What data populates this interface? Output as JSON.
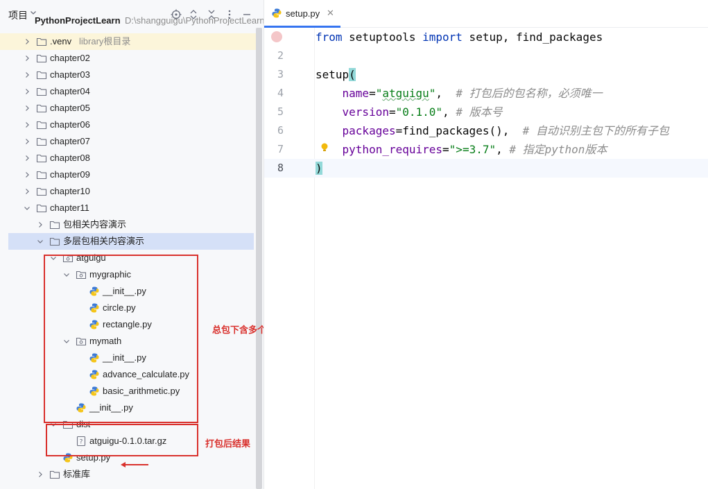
{
  "project_panel": {
    "title": "项目",
    "root": {
      "label": "PythonProjectLearn",
      "path": "D:\\shangguigu\\PythonProjectLearn"
    },
    "tree": [
      {
        "label": ".venv",
        "hint": "library根目录",
        "kind": "folder",
        "expanded": false
      },
      {
        "label": "chapter02",
        "kind": "folder",
        "expanded": false
      },
      {
        "label": "chapter03",
        "kind": "folder",
        "expanded": false
      },
      {
        "label": "chapter04",
        "kind": "folder",
        "expanded": false
      },
      {
        "label": "chapter05",
        "kind": "folder",
        "expanded": false
      },
      {
        "label": "chapter06",
        "kind": "folder",
        "expanded": false
      },
      {
        "label": "chapter07",
        "kind": "folder",
        "expanded": false
      },
      {
        "label": "chapter08",
        "kind": "folder",
        "expanded": false
      },
      {
        "label": "chapter09",
        "kind": "folder",
        "expanded": false
      },
      {
        "label": "chapter10",
        "kind": "folder",
        "expanded": false
      },
      {
        "label": "chapter11",
        "kind": "folder",
        "expanded": true
      },
      {
        "label": "包相关内容演示",
        "kind": "folder",
        "expanded": false
      },
      {
        "label": "多层包相关内容演示",
        "kind": "folder",
        "expanded": true,
        "selected": true
      },
      {
        "label": "atguigu",
        "kind": "package",
        "expanded": true
      },
      {
        "label": "mygraphic",
        "kind": "package",
        "expanded": true
      },
      {
        "label": "__init__.py",
        "kind": "python"
      },
      {
        "label": "circle.py",
        "kind": "python"
      },
      {
        "label": "rectangle.py",
        "kind": "python"
      },
      {
        "label": "mymath",
        "kind": "package",
        "expanded": true
      },
      {
        "label": "__init__.py",
        "kind": "python"
      },
      {
        "label": "advance_calculate.py",
        "kind": "python"
      },
      {
        "label": "basic_arithmetic.py",
        "kind": "python"
      },
      {
        "label": "__init__.py",
        "kind": "python"
      },
      {
        "label": "dist",
        "kind": "folder",
        "expanded": true
      },
      {
        "label": "atguigu-0.1.0.tar.gz",
        "kind": "archive"
      },
      {
        "label": "setup.py",
        "kind": "python"
      },
      {
        "label": "标准库",
        "kind": "folder",
        "expanded": false
      }
    ]
  },
  "annotations": {
    "packages_note": "总包下含多个子包",
    "dist_note": "打包后结果"
  },
  "editor": {
    "tab": {
      "label": "setup.py"
    },
    "current_line": 8,
    "lines": [
      {
        "n": "",
        "tokens": [
          [
            "kw",
            "from"
          ],
          [
            "plain",
            " setuptools "
          ],
          [
            "kw",
            "import"
          ],
          [
            "plain",
            " setup, find_packages"
          ]
        ]
      },
      {
        "n": "2",
        "tokens": []
      },
      {
        "n": "3",
        "tokens": [
          [
            "plain",
            "setup"
          ],
          [
            "bracket",
            "("
          ]
        ]
      },
      {
        "n": "4",
        "tokens": [
          [
            "plain",
            "    "
          ],
          [
            "param",
            "name"
          ],
          [
            "plain",
            "="
          ],
          [
            "str",
            "\""
          ],
          [
            "strsq",
            "atguigu"
          ],
          [
            "str",
            "\""
          ],
          [
            "plain",
            ",  "
          ],
          [
            "cmt",
            "# 打包后的包名称，必须唯一"
          ]
        ]
      },
      {
        "n": "5",
        "tokens": [
          [
            "plain",
            "    "
          ],
          [
            "param",
            "version"
          ],
          [
            "plain",
            "="
          ],
          [
            "str",
            "\"0.1.0\""
          ],
          [
            "plain",
            ", "
          ],
          [
            "cmt",
            "# 版本号"
          ]
        ]
      },
      {
        "n": "6",
        "tokens": [
          [
            "plain",
            "    "
          ],
          [
            "param",
            "packages"
          ],
          [
            "plain",
            "=find_packages(),  "
          ],
          [
            "cmt",
            "# 自动识别主包下的所有子包"
          ]
        ]
      },
      {
        "n": "7",
        "tokens": [
          [
            "plain",
            "    "
          ],
          [
            "param",
            "python_requires"
          ],
          [
            "plain",
            "="
          ],
          [
            "str",
            "\">=3.7\""
          ],
          [
            "plain",
            ", "
          ],
          [
            "cmt",
            "# 指定python版本"
          ]
        ]
      },
      {
        "n": "8",
        "tokens": [
          [
            "bracket",
            ")"
          ]
        ]
      }
    ]
  },
  "colors": {
    "accent": "#3574f0",
    "annotation_red": "#d9302c",
    "keyword": "#0033b3",
    "string": "#067d17",
    "param": "#660099",
    "comment": "#8c8c8c"
  }
}
